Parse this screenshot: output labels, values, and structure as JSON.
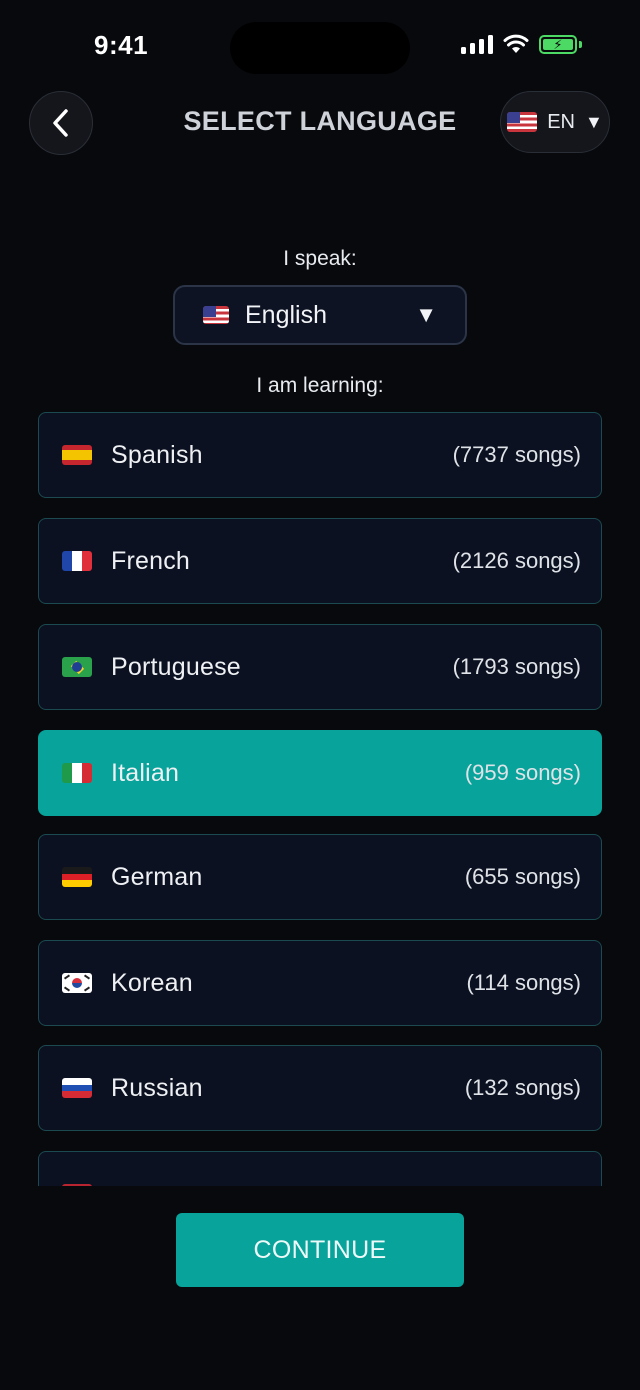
{
  "status_bar": {
    "time": "9:41",
    "battery_color": "#4cd964"
  },
  "header": {
    "title": "SELECT LANGUAGE",
    "back_icon": "chevron-left-icon",
    "ui_language": {
      "flag": "us",
      "code": "EN",
      "caret": "▼"
    }
  },
  "speak": {
    "label": "I speak:",
    "selected": {
      "flag": "us",
      "name": "English"
    },
    "caret": "▼"
  },
  "learning": {
    "label": "I am learning:",
    "languages": [
      {
        "flag": "es",
        "name": "Spanish",
        "count": "(7737 songs)",
        "selected": false
      },
      {
        "flag": "fr",
        "name": "French",
        "count": "(2126 songs)",
        "selected": false
      },
      {
        "flag": "br",
        "name": "Portuguese",
        "count": "(1793 songs)",
        "selected": false
      },
      {
        "flag": "it",
        "name": "Italian",
        "count": "(959 songs)",
        "selected": true
      },
      {
        "flag": "de",
        "name": "German",
        "count": "(655 songs)",
        "selected": false
      },
      {
        "flag": "kr",
        "name": "Korean",
        "count": "(114 songs)",
        "selected": false
      },
      {
        "flag": "ru",
        "name": "Russian",
        "count": "(132 songs)",
        "selected": false
      },
      {
        "flag": "nl",
        "name": "",
        "count": "",
        "selected": false
      }
    ]
  },
  "continue_label": "CONTINUE",
  "colors": {
    "accent": "#08a39a",
    "background": "#07090d",
    "item_background": "#0b1120",
    "item_border": "#1b4a50"
  }
}
